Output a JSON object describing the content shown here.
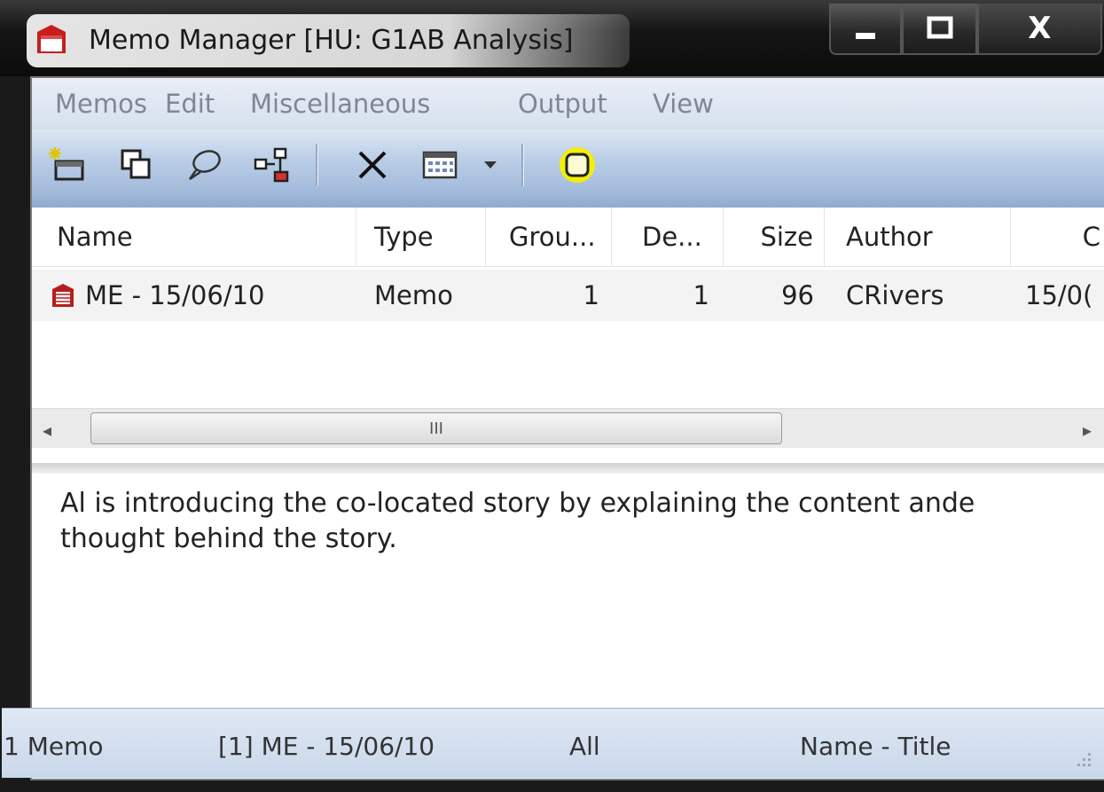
{
  "window": {
    "title": "Memo Manager [HU: G1AB Analysis]",
    "controls": {
      "minimize": "▬",
      "maximize": "☐",
      "close": "X"
    }
  },
  "menu": [
    "Memos",
    "Edit",
    "Miscellaneous",
    "Output",
    "View"
  ],
  "toolbar": {
    "icons": [
      "new-memo-icon",
      "duplicate-icon",
      "comment-icon",
      "network-icon",
      "delete-icon",
      "calendar-icon",
      "dropdown-arrow-icon",
      "highlight-icon"
    ]
  },
  "list": {
    "columns": [
      "Name",
      "Type",
      "Grou...",
      "De...",
      "Size",
      "Author",
      "C"
    ],
    "rows": [
      {
        "name": "ME - 15/06/10",
        "type": "Memo",
        "groups": "1",
        "density": "1",
        "size": "96",
        "author": "CRivers",
        "created": "15/0("
      }
    ],
    "scroll_thumb_label": "III"
  },
  "memo_body": "Al is introducing the co-located story by explaining the content ande thought behind the story.",
  "status": {
    "count": "1 Memo",
    "selected": "[1] ME - 15/06/10",
    "filter": "All",
    "sort": "Name - Title"
  }
}
